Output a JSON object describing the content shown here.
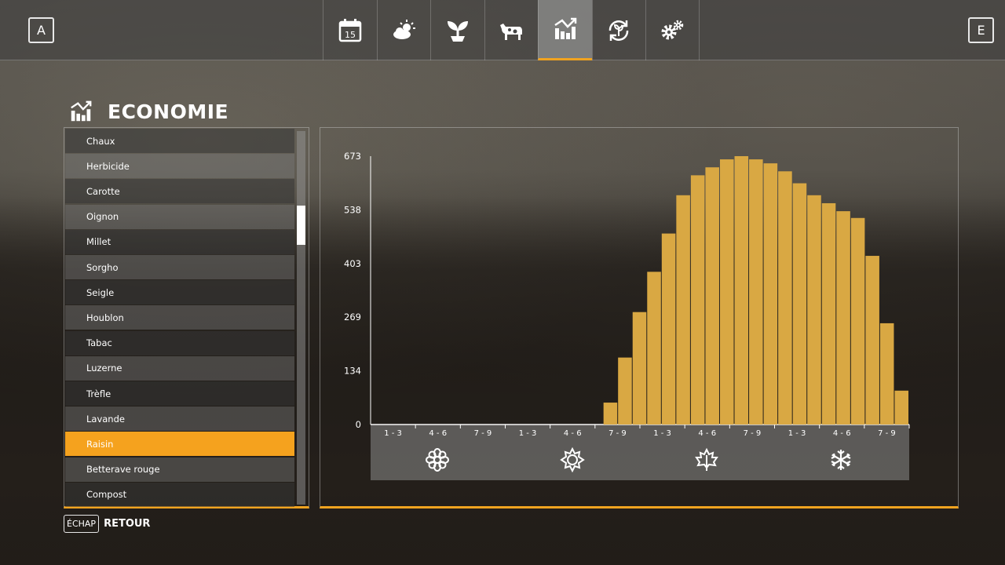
{
  "header": {
    "left_key": "A",
    "right_key": "E",
    "tabs": [
      {
        "icon": "calendar-icon",
        "label": "15"
      },
      {
        "icon": "weather-icon"
      },
      {
        "icon": "crops-icon"
      },
      {
        "icon": "animals-icon"
      },
      {
        "icon": "economy-icon",
        "active": true
      },
      {
        "icon": "contracts-icon"
      },
      {
        "icon": "settings-icon"
      }
    ]
  },
  "page": {
    "title": "ECONOMIE"
  },
  "list": {
    "items": [
      "Chaux",
      "Herbicide",
      "Carotte",
      "Oignon",
      "Millet",
      "Sorgho",
      "Seigle",
      "Houblon",
      "Tabac",
      "Luzerne",
      "Trèfle",
      "Lavande",
      "Raisin",
      "Betterave rouge",
      "Compost"
    ],
    "selected": "Raisin",
    "scroll_position": 0.2
  },
  "chart_data": {
    "type": "bar",
    "y_ticks": [
      "673",
      "538",
      "403",
      "269",
      "134",
      "0"
    ],
    "ylim": [
      0,
      673
    ],
    "categories": [
      "1 - 3",
      "4 - 6",
      "7 - 9",
      "1 - 3",
      "4 - 6",
      "7 - 9",
      "1 - 3",
      "4 - 6",
      "7 - 9",
      "1 - 3",
      "4 - 6",
      "7 - 9"
    ],
    "seasons": [
      "spring",
      "summer",
      "autumn",
      "winter"
    ],
    "values": [
      0,
      0,
      0,
      0,
      0,
      0,
      0,
      0,
      0,
      0,
      0,
      0,
      0,
      0,
      0,
      0,
      55,
      168,
      282,
      383,
      479,
      575,
      625,
      645,
      665,
      673,
      665,
      655,
      635,
      605,
      575,
      555,
      535,
      518,
      423,
      254,
      85
    ],
    "bar_color": "#d9a843"
  },
  "footer": {
    "esc_key": "ÉCHAP",
    "back_label": "RETOUR"
  },
  "colors": {
    "accent": "#f5a21e"
  }
}
